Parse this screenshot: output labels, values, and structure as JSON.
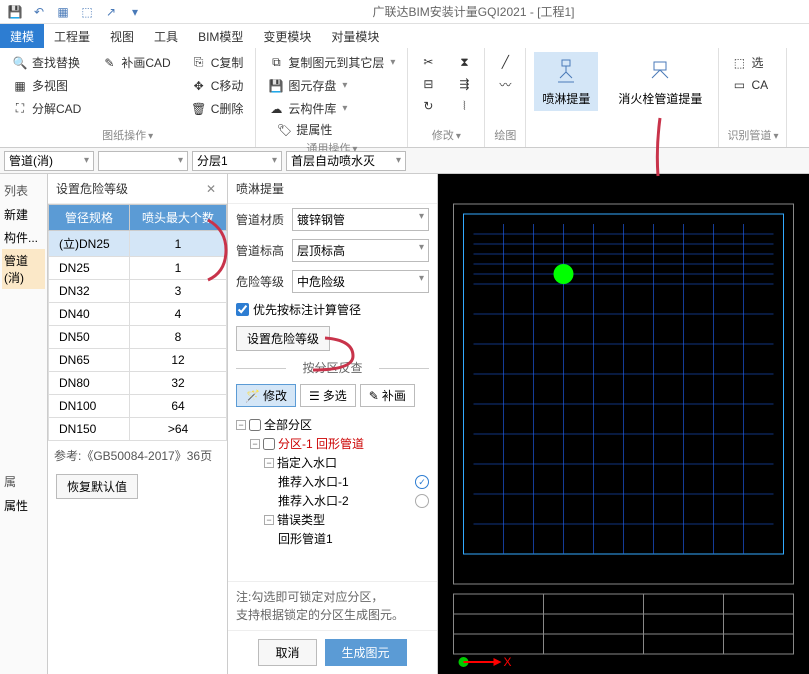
{
  "app": {
    "title": "广联达BIM安装计量GQI2021 - [工程1]"
  },
  "menus": [
    "建模",
    "工程量",
    "视图",
    "工具",
    "BIM模型",
    "变更模块",
    "对量模块"
  ],
  "ribbon": {
    "g1": {
      "find_replace": "查找替换",
      "fill_cad": "补画CAD",
      "multi_view": "多视图",
      "split_cad": "分解CAD",
      "c_copy": "C复制",
      "c_move": "C移动",
      "c_delete": "C删除",
      "drawing_ops": "图纸操作"
    },
    "g2": {
      "copy_to_layer": "复制图元到其它层",
      "set_attr": "提属性",
      "element_save": "图元存盘",
      "cloud_lib": "云构件库",
      "general_ops": "通用操作"
    },
    "g3": {
      "modify": "修改"
    },
    "g4": {
      "draw": "绘图"
    },
    "g5": {
      "spray_extract": "喷淋提量",
      "hydrant_extract": "消火栓管道提量"
    },
    "g6": {
      "select": "选",
      "cad": "CA",
      "identify_pipe": "识别管道"
    }
  },
  "selectors": {
    "pipe": "管道(消)",
    "empty": "",
    "layer": "分层1",
    "auto": "首层自动喷水灭"
  },
  "left": {
    "list": "列表",
    "new": "新建",
    "component": "构件...",
    "pipe": "管道(消)",
    "attr": "属",
    "attr2": "属性"
  },
  "risk": {
    "title": "设置危险等级",
    "th1": "管径规格",
    "th2": "喷头最大个数",
    "rows": [
      {
        "spec": "(立)DN25",
        "count": "1"
      },
      {
        "spec": "DN25",
        "count": "1"
      },
      {
        "spec": "DN32",
        "count": "3"
      },
      {
        "spec": "DN40",
        "count": "4"
      },
      {
        "spec": "DN50",
        "count": "8"
      },
      {
        "spec": "DN65",
        "count": "12"
      },
      {
        "spec": "DN80",
        "count": "32"
      },
      {
        "spec": "DN100",
        "count": "64"
      },
      {
        "spec": "DN150",
        "count": ">64"
      }
    ],
    "ref": "参考:《GB50084-2017》36页",
    "restore": "恢复默认值"
  },
  "spray": {
    "title": "喷淋提量",
    "material_lbl": "管道材质",
    "material_val": "镀锌钢管",
    "elev_lbl": "管道标高",
    "elev_val": "层顶标高",
    "risk_lbl": "危险等级",
    "risk_val": "中危险级",
    "check_lbl": "优先按标注计算管径",
    "set_risk": "设置危险等级",
    "section": "按分区反查",
    "seg_modify": "修改",
    "seg_multi": "多选",
    "seg_fill": "补画",
    "tree": {
      "all": "全部分区",
      "zone1": "分区-1 回形管道",
      "inlet": "指定入水口",
      "inlet1": "推荐入水口-1",
      "inlet2": "推荐入水口-2",
      "error": "错误类型",
      "ring": "回形管道1"
    },
    "note1": "注:勾选即可锁定对应分区，",
    "note2": "支持根据锁定的分区生成图元。",
    "cancel": "取消",
    "generate": "生成图元"
  }
}
